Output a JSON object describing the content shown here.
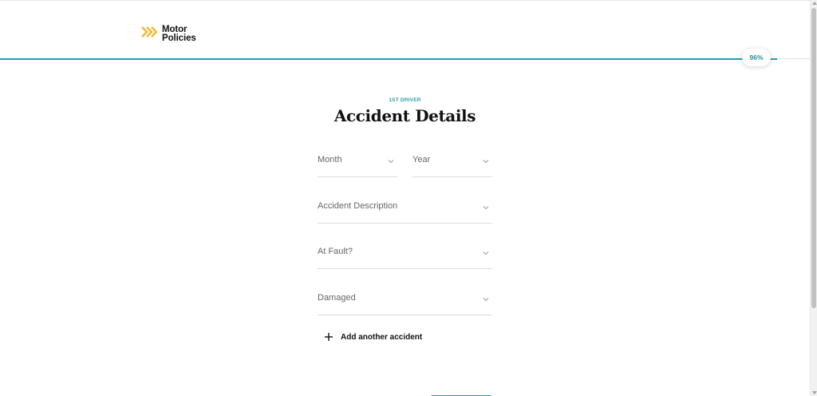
{
  "header": {
    "logo_line1": "Motor",
    "logo_line2": "Policies",
    "logo_icon": "double-chevron-right-icon",
    "brand_accent": "#f5b82e"
  },
  "progress": {
    "percent": 96,
    "label": "96%",
    "color": "#2a9fa7"
  },
  "form": {
    "eyebrow": "1ST DRIVER",
    "title": "Accident Details",
    "fields": {
      "month": {
        "label": "Month"
      },
      "year": {
        "label": "Year"
      },
      "description": {
        "label": "Accident Description"
      },
      "at_fault": {
        "label": "At Fault?"
      },
      "damaged": {
        "label": "Damaged"
      }
    },
    "add_label": "Add another accident"
  }
}
